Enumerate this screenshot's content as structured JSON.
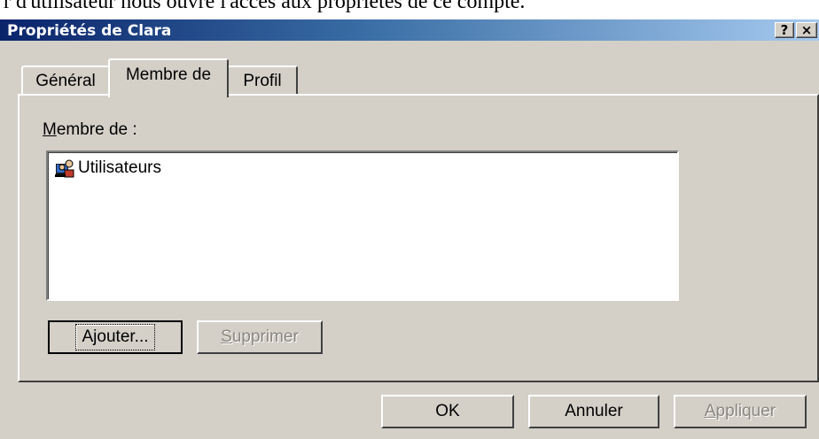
{
  "document": {
    "text": "r d'utilisateur nous ouvre l'accès aux propriétés de ce compte."
  },
  "window": {
    "title": "Propriétés de Clara",
    "help_button": "?",
    "close_button": "×"
  },
  "tabs": [
    {
      "label": "Général"
    },
    {
      "label": "Membre de",
      "active": true
    },
    {
      "label": "Profil"
    }
  ],
  "panel": {
    "section_label": "Membre de :",
    "members": [
      {
        "name": "Utilisateurs",
        "icon": "group-icon"
      }
    ],
    "add_button": "Ajouter...",
    "remove_button": "Supprimer"
  },
  "footer": {
    "ok": "OK",
    "cancel": "Annuler",
    "apply": "Appliquer"
  },
  "colors": {
    "title_gradient_start": "#0a246a",
    "title_gradient_end": "#a6caf0",
    "face": "#d4d0c8",
    "disabled_text": "#8a8680"
  }
}
